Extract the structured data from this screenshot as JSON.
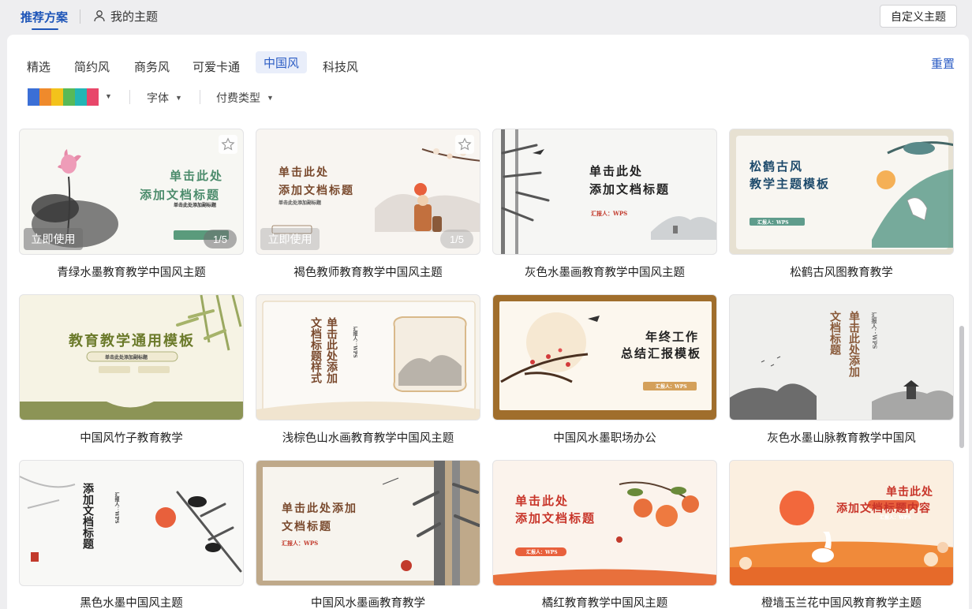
{
  "top": {
    "tab_recommended": "推荐方案",
    "tab_mine": "我的主题",
    "custom_button": "自定义主题"
  },
  "categories": [
    "精选",
    "简约风",
    "商务风",
    "可爱卡通",
    "中国风",
    "科技风"
  ],
  "active_category": "中国风",
  "reset_label": "重置",
  "filters": {
    "colors": [
      "#3b6fd6",
      "#ef8a2c",
      "#f3c21b",
      "#58b957",
      "#23b5b5",
      "#e8476a"
    ],
    "font_label": "字体",
    "pay_label": "付费类型"
  },
  "hover_overlay": {
    "use_label": "立即使用",
    "page_badge": "1/5"
  },
  "cards": [
    {
      "title": "青绿水墨教育教学中国风主题",
      "thumb_line1": "单击此处",
      "thumb_line2": "添加文档标题",
      "thumb_sub": "单击此处添加副标题"
    },
    {
      "title": "褐色教师教育教学中国风主题",
      "thumb_line1": "单击此处",
      "thumb_line2": "添加文档标题",
      "thumb_sub": "单击此处添加副标题"
    },
    {
      "title": "灰色水墨画教育教学中国风主题",
      "thumb_line1": "单击此处",
      "thumb_line2": "添加文档标题",
      "thumb_sub": "汇报人：WPS"
    },
    {
      "title": "松鹤古风图教育教学",
      "thumb_line1": "松鹤古风",
      "thumb_line2": "教学主题模板",
      "thumb_sub": "汇报人：WPS"
    },
    {
      "title": "中国风竹子教育教学",
      "thumb_line1": "教育教学通用模板",
      "thumb_line2": "",
      "thumb_sub": "单击此处添加副标题"
    },
    {
      "title": "浅棕色山水画教育教学中国风主题",
      "thumb_line1": "单击此处添加",
      "thumb_line2": "文档标题样式",
      "thumb_sub": "汇报人：WPS"
    },
    {
      "title": "中国风水墨职场办公",
      "thumb_line1": "年终工作",
      "thumb_line2": "总结汇报模板",
      "thumb_sub": "汇报人：WPS"
    },
    {
      "title": "灰色水墨山脉教育教学中国风",
      "thumb_line1": "单击此处添加",
      "thumb_line2": "文档标题",
      "thumb_sub": "汇报人：WPS"
    },
    {
      "title": "黑色水墨中国风主题",
      "thumb_line1": "添加文档标题",
      "thumb_line2": "",
      "thumb_sub": "汇报人：WPS"
    },
    {
      "title": "中国风水墨画教育教学",
      "thumb_line1": "单击此处添加",
      "thumb_line2": "文档标题",
      "thumb_sub": "汇报人：WPS"
    },
    {
      "title": "橘红教育教学中国风主题",
      "thumb_line1": "单击此处",
      "thumb_line2": "添加文档标题",
      "thumb_sub": "汇报人：WPS"
    },
    {
      "title": "橙墙玉兰花中国风教育教学主题",
      "thumb_line1": "单击此处",
      "thumb_line2": "添加文档标题内容",
      "thumb_sub": "汇报人：WPS"
    }
  ]
}
